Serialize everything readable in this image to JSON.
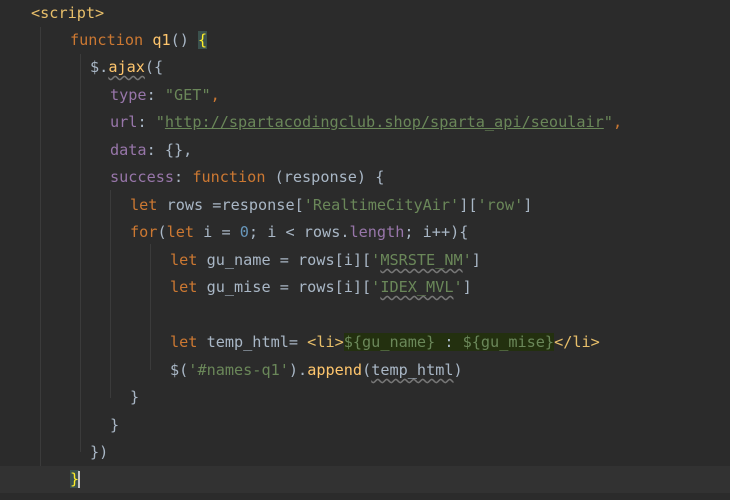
{
  "lines": {
    "l1": {
      "open": "<",
      "tag": "script",
      "close": ">"
    },
    "l2": {
      "kw": "function",
      "name": "q1",
      "parens": "() ",
      "brace": "{"
    },
    "l3": {
      "dollar": "$",
      "dot": ".",
      "method": "ajax",
      "open": "({"
    },
    "l4": {
      "key": "type",
      "colon": ": ",
      "value": "\"GET\"",
      "comma": ","
    },
    "l5": {
      "key": "url",
      "colon": ": ",
      "q1": "\"",
      "url": "http://spartacodingclub.shop/sparta_api/seoulair",
      "q2": "\"",
      "comma": ","
    },
    "l6": {
      "key": "data",
      "rest": ": {},"
    },
    "l7": {
      "key": "success",
      "colon": ": ",
      "kw": "function",
      "rest": " (response) {"
    },
    "l8": {
      "kw": "let",
      "a": " rows =response[",
      "s1": "'RealtimeCityAir'",
      "b": "][",
      "s2": "'row'",
      "c": "]"
    },
    "l9": {
      "kw1": "for",
      "a": "(",
      "kw2": "let",
      "b": " i = ",
      "num": "0",
      "c": "; i < rows.",
      "prop": "length",
      "d": "; i++){"
    },
    "l10": {
      "kw": "let",
      "a": " gu_name = rows[i][",
      "q1": "'",
      "s": "MSRSTE_NM",
      "q2": "'",
      "b": "]"
    },
    "l11": {
      "kw": "let",
      "a": " gu_mise = rows[i][",
      "q1": "'",
      "s": "IDEX_MVL",
      "q2": "'",
      "b": "]"
    },
    "l13": {
      "kw": "let",
      "a": " temp_html= ",
      "t1": "<li>",
      "i1": "${gu_name}",
      "mid": " : ",
      "i2": "${gu_mise}",
      "t2": "</li>"
    },
    "l14": {
      "a": "$(",
      "s": "'#names-q1'",
      "b": ").",
      "method": "append",
      "c": "(",
      "arg": "temp_html",
      "d": ")"
    },
    "l15": {
      "text": "}"
    },
    "l16": {
      "text": "}"
    },
    "l17": {
      "text": "})"
    },
    "l18": {
      "text": "}"
    }
  },
  "colors": {
    "background": "#2b2b2b",
    "keyword": "#cc7832",
    "string": "#6a8759",
    "function": "#ffc66d",
    "property": "#9876aa",
    "number": "#6897bb",
    "tag": "#e8bf6a",
    "text": "#a9b7c6"
  }
}
